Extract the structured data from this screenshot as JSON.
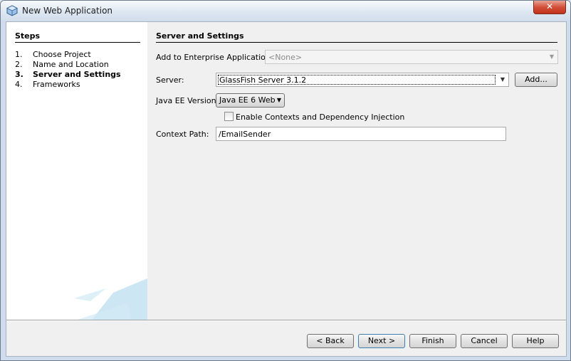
{
  "window": {
    "title": "New Web Application",
    "close_glyph": "✕"
  },
  "steps": {
    "title": "Steps",
    "items": [
      {
        "num": "1.",
        "label": "Choose Project"
      },
      {
        "num": "2.",
        "label": "Name and Location"
      },
      {
        "num": "3.",
        "label": "Server and Settings"
      },
      {
        "num": "4.",
        "label": "Frameworks"
      }
    ],
    "current_index": 2
  },
  "settings": {
    "title": "Server and Settings",
    "enterprise_label": "Add to Enterprise Application:",
    "enterprise_value": "<None>",
    "server_label": "Server:",
    "server_value": "GlassFish Server 3.1.2",
    "add_label": "Add...",
    "javaee_label": "Java EE Version:",
    "javaee_value": "Java EE 6 Web",
    "cdi_label": "Enable Contexts and Dependency Injection",
    "cdi_checked": false,
    "context_label": "Context Path:",
    "context_value": "/EmailSender"
  },
  "buttons": {
    "back": "< Back",
    "next": "Next >",
    "finish": "Finish",
    "cancel": "Cancel",
    "help": "Help"
  },
  "icons": {
    "app": "netbeans-cube-icon",
    "dropdown": "chevron-down-icon",
    "close": "close-icon"
  }
}
